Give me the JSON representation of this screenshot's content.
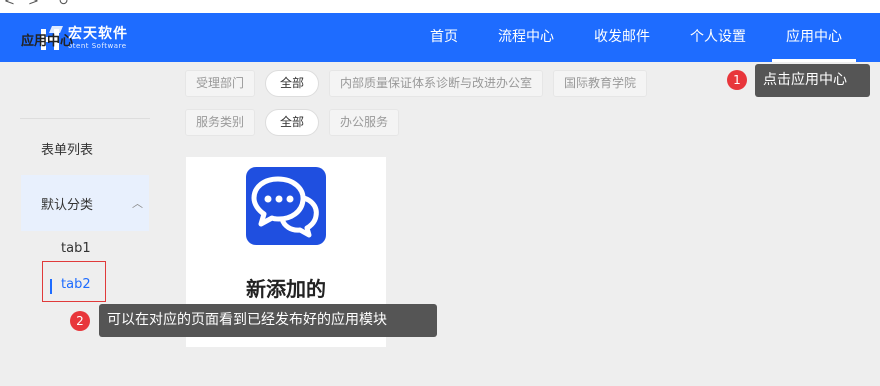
{
  "browser": {
    "url_fragment": "…／．…／／．．．／ｐ"
  },
  "header": {
    "logo_cn": "宏天软件",
    "logo_en": "otent Software",
    "nav": [
      {
        "label": "首页"
      },
      {
        "label": "流程中心"
      },
      {
        "label": "收发邮件"
      },
      {
        "label": "个人设置"
      },
      {
        "label": "应用中心",
        "active": true
      }
    ],
    "brand_color": "#1e6cff"
  },
  "sidebar": {
    "title": "应用中心",
    "link": "表单列表",
    "group": {
      "label": "默认分类",
      "chevron": "chevron-up-icon"
    },
    "subitems": [
      {
        "label": "tab1"
      },
      {
        "label": "tab2",
        "active": true
      }
    ]
  },
  "filters": {
    "department": {
      "label": "受理部门",
      "options": [
        "全部",
        "内部质量保证体系诊断与改进办公室",
        "国际教育学院"
      ],
      "selected": "全部"
    },
    "service_type": {
      "label": "服务类别",
      "options": [
        "全部",
        "办公服务"
      ],
      "selected": "全部"
    }
  },
  "apps": [
    {
      "name": "新添加的",
      "icon": "chat-bubbles-icon"
    }
  ],
  "tips": [
    {
      "number": "1",
      "text": "点击应用中心"
    },
    {
      "number": "2",
      "text": "可以在对应的页面看到已经发布好的应用模块"
    }
  ]
}
